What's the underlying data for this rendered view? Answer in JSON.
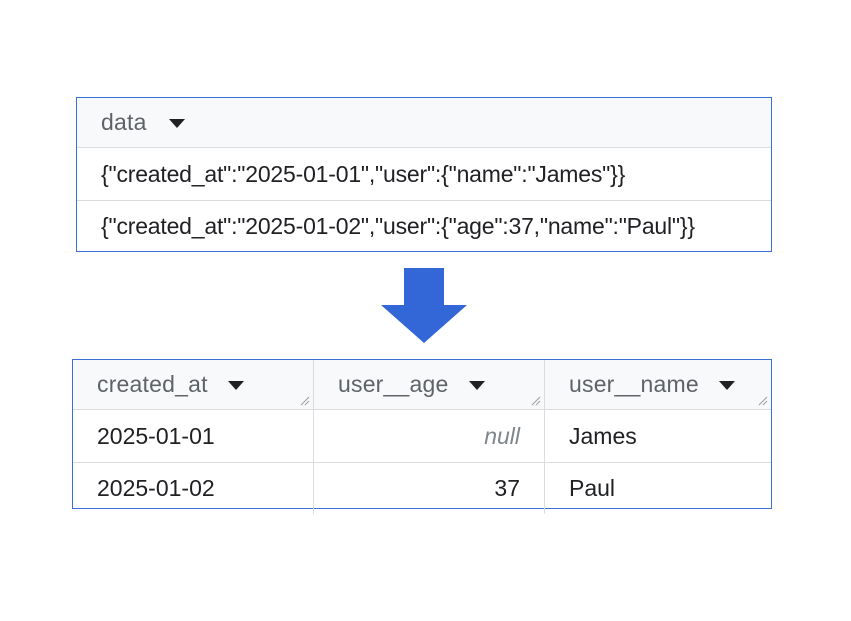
{
  "source": {
    "column": "data",
    "rows": [
      "{\"created_at\":\"2025-01-01\",\"user\":{\"name\":\"James\"}}",
      "{\"created_at\":\"2025-01-02\",\"user\":{\"age\":37,\"name\":\"Paul\"}}"
    ]
  },
  "arrow": {
    "icon": "down-arrow-icon",
    "color": "#3366d6"
  },
  "result": {
    "columns": [
      "created_at",
      "user__age",
      "user__name"
    ],
    "rows": [
      {
        "created_at": "2025-01-01",
        "user__age": "null",
        "user__name": "James"
      },
      {
        "created_at": "2025-01-02",
        "user__age": "37",
        "user__name": "Paul"
      }
    ]
  },
  "colors": {
    "border": "#3a6fd8",
    "header_bg": "#f8f9fa",
    "grid": "#dadce0",
    "null_text": "#80868b"
  }
}
